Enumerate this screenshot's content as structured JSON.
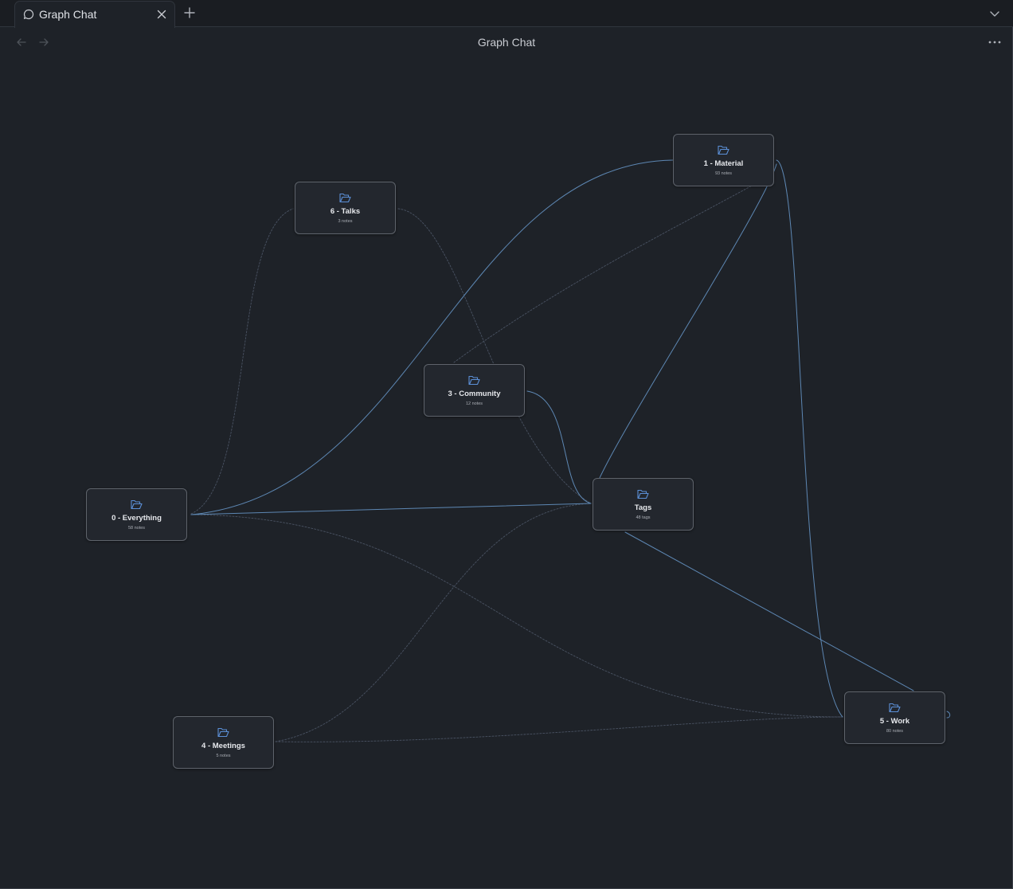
{
  "tab": {
    "label": "Graph Chat",
    "icon": "chat-bubble-icon"
  },
  "header": {
    "title": "Graph Chat"
  },
  "colors": {
    "background": "#1e2228",
    "node_border": "#5e636b",
    "edge_strong": "#5d87b3",
    "edge_weak": "#4a5363",
    "folder_icon": "#5b8fd6"
  },
  "nodes": [
    {
      "id": "material",
      "title": "1 - Material",
      "count": "93 notes"
    },
    {
      "id": "talks",
      "title": "6 - Talks",
      "count": "3 notes"
    },
    {
      "id": "community",
      "title": "3 - Community",
      "count": "12 notes"
    },
    {
      "id": "tags",
      "title": "Tags",
      "count": "48 tags"
    },
    {
      "id": "everything",
      "title": "0 - Everything",
      "count": "58 notes"
    },
    {
      "id": "meetings",
      "title": "4 - Meetings",
      "count": "5 notes"
    },
    {
      "id": "work",
      "title": "5 - Work",
      "count": "80 notes"
    }
  ]
}
